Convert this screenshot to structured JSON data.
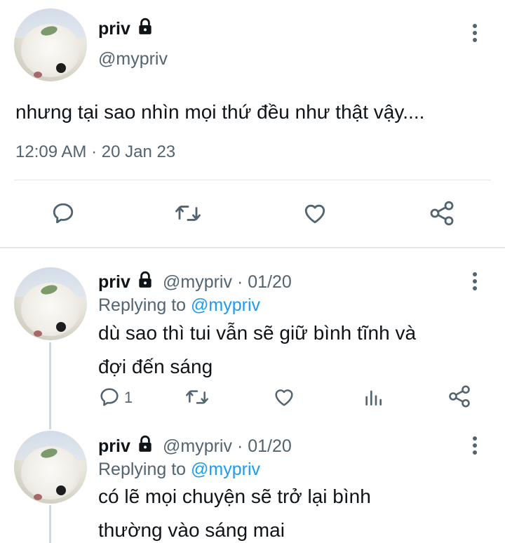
{
  "main_tweet": {
    "name": "priv",
    "handle": "@mypriv",
    "text": "nhưng tại sao nhìn mọi thứ đều như thật vậy....",
    "timestamp": "12:09 AM · 20 Jan 23",
    "actions": [
      "reply-icon",
      "retweet-icon",
      "like-icon",
      "share-icon"
    ]
  },
  "replies": [
    {
      "name": "priv",
      "handle": "@mypriv",
      "date": "01/20",
      "replying_label": "Replying to",
      "replying_to": "@mypriv",
      "text": "dù sao thì tui vẫn sẽ giữ bình tĩnh và đợi đến sáng",
      "reply_count": "1",
      "actions": [
        "reply-icon",
        "retweet-icon",
        "like-icon",
        "analytics-icon",
        "share-icon"
      ]
    },
    {
      "name": "priv",
      "handle": "@mypriv",
      "date": "01/20",
      "replying_label": "Replying to",
      "replying_to": "@mypriv",
      "text": "có lẽ mọi chuyện sẽ trở lại bình thường vào sáng mai"
    }
  ],
  "colors": {
    "text": "#0f1419",
    "secondary": "#536471",
    "accent": "#1d9bf0",
    "divider": "#e4e7ea"
  }
}
